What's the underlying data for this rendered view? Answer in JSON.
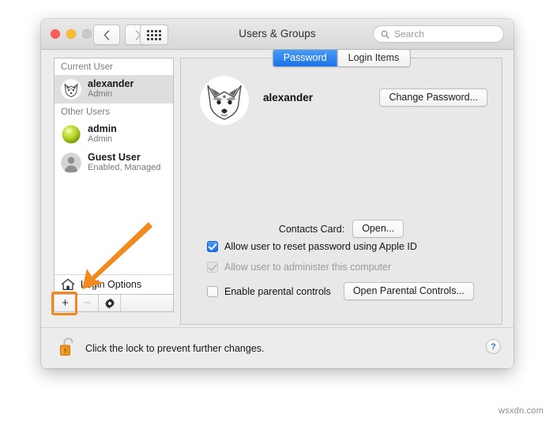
{
  "window": {
    "title": "Users & Groups",
    "traffic_lights": [
      "close",
      "minimize",
      "zoom"
    ],
    "nav": {
      "back_icon": "chevron-left-icon",
      "forward_icon": "chevron-right-icon",
      "grid_icon": "show-all-grid-icon"
    },
    "search": {
      "placeholder": "Search",
      "icon": "search-icon",
      "value": ""
    }
  },
  "sidebar": {
    "groups": [
      {
        "header": "Current User",
        "users": [
          {
            "name": "alexander",
            "subtitle": "Admin",
            "avatar": "fox-avatar",
            "selected": true
          }
        ]
      },
      {
        "header": "Other Users",
        "users": [
          {
            "name": "admin",
            "subtitle": "Admin",
            "avatar": "green-sphere-avatar",
            "selected": false
          },
          {
            "name": "Guest User",
            "subtitle": "Enabled, Managed",
            "avatar": "person-silhouette-avatar",
            "selected": false
          }
        ]
      }
    ],
    "login_options": {
      "label": "Login Options",
      "icon": "house-icon"
    },
    "toolbar": {
      "add_label": "+",
      "remove_label": "−",
      "settings_icon": "gear-icon",
      "add_highlighted": true,
      "remove_enabled": false
    }
  },
  "panel": {
    "tabs": [
      {
        "label": "Password",
        "active": true
      },
      {
        "label": "Login Items",
        "active": false
      }
    ],
    "account": {
      "name": "alexander",
      "avatar": "fox-avatar"
    },
    "change_password_button": "Change Password...",
    "contacts_card": {
      "label": "Contacts Card:",
      "button": "Open..."
    },
    "checkboxes": [
      {
        "label": "Allow user to reset password using Apple ID",
        "checked": true,
        "enabled": true
      },
      {
        "label": "Allow user to administer this computer",
        "checked": true,
        "enabled": false
      },
      {
        "label": "Enable parental controls",
        "checked": false,
        "enabled": true
      }
    ],
    "parental_controls_button": "Open Parental Controls..."
  },
  "bottom": {
    "lock_icon": "unlocked-padlock-icon",
    "lock_text": "Click the lock to prevent further changes.",
    "help_label": "?"
  },
  "annotation": {
    "arrow_color": "#f08a1e",
    "highlight_color": "#f08a1e",
    "target": "add-user-button"
  },
  "watermark": "wsxdn.com"
}
